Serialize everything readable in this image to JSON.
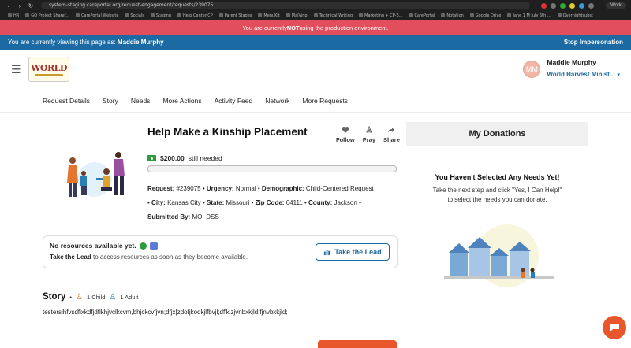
{
  "browser": {
    "url": "system-staging.careportal.org/request-engagement/requests/239075",
    "profile": "Work",
    "bookmarks": [
      "HR",
      "GO Project Sharef...",
      "CarePortal Website",
      "Socials",
      "Staging",
      "Help Center-CP",
      "Parent Stages",
      "MenuKit",
      "MajVinp",
      "Technical Writing",
      "Marketing + CP-S...",
      "CarePortal",
      "Notation",
      "Google Drive",
      "Jane 1 M July 6th ...",
      "Overnightsubst"
    ]
  },
  "env_banner": {
    "prefix": "You are currently ",
    "emphasis": "NOT",
    "suffix": " using the production environment."
  },
  "impersonation": {
    "prefix": "You are currently viewing this page as: ",
    "name": "Maddie Murphy",
    "stop_label": "Stop Impersonation"
  },
  "header": {
    "menu_icon": "hamburger-icon",
    "logo_text": "WORLD",
    "user": {
      "initials": "MM",
      "name": "Maddie Murphy",
      "org": "World Harvest Minist..."
    }
  },
  "tabs": [
    "Request Details",
    "Story",
    "Needs",
    "More Actions",
    "Activity Feed",
    "Network",
    "More Requests"
  ],
  "request": {
    "title": "Help Make a Kinship Placement",
    "actions": [
      {
        "label": "Follow",
        "icon": "heart-icon"
      },
      {
        "label": "Pray",
        "icon": "pray-icon"
      },
      {
        "label": "Share",
        "icon": "share-icon"
      }
    ],
    "amount": "$200.00",
    "amount_suffix": "still needed",
    "progress": 0,
    "meta": {
      "request_label": "Request:",
      "request_value": "#239075",
      "urgency_label": "Urgency:",
      "urgency_value": "Normal",
      "demographic_label": "Demographic:",
      "demographic_value": "Child-Centered Request",
      "city_label": "City:",
      "city_value": "Kansas City",
      "state_label": "State:",
      "state_value": "Missouri",
      "zip_label": "Zip Code:",
      "zip_value": "64111",
      "county_label": "County:",
      "county_value": "Jackson",
      "submitted_label": "Submitted By:",
      "submitted_value": "MO- DSS",
      "bullet": "•"
    }
  },
  "resources": {
    "title": "No resources available yet.",
    "sub_emphasis": "Take the Lead",
    "sub_rest": " to access resources as soon as they become available.",
    "button_label": "Take the Lead"
  },
  "story": {
    "title": "Story",
    "bullet": "•",
    "child_count": "1 Child",
    "adult_count": "1 Adult",
    "text": "testersihfvsdfixkdfjdflkhjvclkcvm,bhjckcvfjvn;dfjx[zdofjkodkjlfbvjl;df'klzjvnbxkjld;fjnvbxkjld;"
  },
  "donations": {
    "title": "My Donations",
    "empty_title": "You Haven't Selected Any Needs Yet!",
    "empty_line1": "Take the next step and click \"Yes, I Can Help!\"",
    "empty_line2": "to select the needs you can donate."
  },
  "colors": {
    "accent": "#1c6aa3",
    "danger": "#e24e5c",
    "cta": "#e8562c",
    "success": "#2e9b3a"
  }
}
